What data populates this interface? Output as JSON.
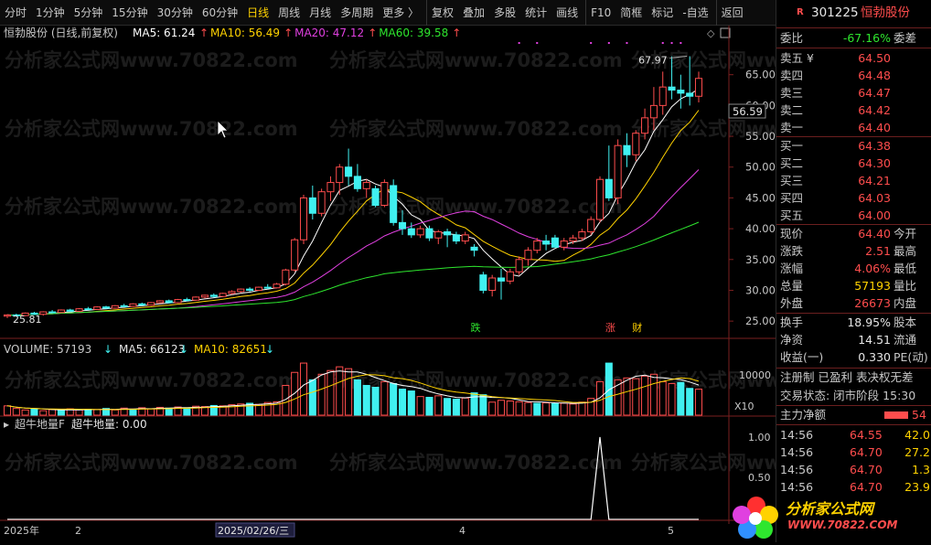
{
  "toolbar": {
    "items": [
      "分时",
      "1分钟",
      "5分钟",
      "15分钟",
      "30分钟",
      "60分钟",
      "日线",
      "周线",
      "月线",
      "多周期",
      "更多 〉",
      "复权",
      "叠加",
      "多股",
      "统计",
      "画线",
      "F10",
      "简框",
      "标记",
      "-自选",
      "返回"
    ],
    "active": "日线"
  },
  "stock": {
    "code": "301225",
    "name": "恒勃股份",
    "market_badge": "R"
  },
  "price_panel": {
    "title": "恒勃股份 (日线,前复权)",
    "ma": [
      {
        "label": "MA5: 61.24",
        "color": "#ffffff"
      },
      {
        "label": "MA10: 56.49",
        "color": "#ffd200"
      },
      {
        "label": "MA20: 47.12",
        "color": "#e040e0"
      },
      {
        "label": "MA60: 39.58",
        "color": "#2ee62e"
      }
    ],
    "up_arrow": "↑",
    "current_price_tag": "56.59",
    "high_label": "67.97",
    "low_label": "25.81",
    "events": [
      "跌",
      "涨",
      "财"
    ],
    "watermark": "分析家公式网www.70822.com"
  },
  "volume_panel": {
    "title": "VOLUME: 57193",
    "ma5": "MA5: 66123",
    "ma10": "MA10: 82651",
    "down_arrow": "↓",
    "unit_label": "X10",
    "tick": "10000"
  },
  "indicator_panel": {
    "title": "超牛地量F",
    "value": "超牛地量: 0.00",
    "ticks": [
      "1.00",
      "0.50"
    ]
  },
  "x_axis": {
    "labels": [
      "2025年",
      "2",
      "2025/02/26/三",
      "4",
      "5"
    ]
  },
  "logo": {
    "text": "分析家公式网",
    "url_text": "WWW.70822.COM"
  },
  "chart_data": [
    {
      "type": "candlestick",
      "title": "恒勃股份 (日线,前复权)",
      "ylim": [
        22.5,
        70
      ],
      "yticks": [
        25,
        30,
        35,
        40,
        45,
        50,
        55,
        60,
        65
      ],
      "candles": [
        [
          25.8,
          26.1,
          25.5,
          26.0
        ],
        [
          26.0,
          26.2,
          25.7,
          25.9
        ],
        [
          25.9,
          26.4,
          25.8,
          26.3
        ],
        [
          26.3,
          26.5,
          26.0,
          26.1
        ],
        [
          26.1,
          26.6,
          25.9,
          26.5
        ],
        [
          26.5,
          26.8,
          26.3,
          26.4
        ],
        [
          26.4,
          26.9,
          26.3,
          26.8
        ],
        [
          26.8,
          27.0,
          26.5,
          26.6
        ],
        [
          26.6,
          27.1,
          26.5,
          27.0
        ],
        [
          27.0,
          27.3,
          26.8,
          26.9
        ],
        [
          26.9,
          27.4,
          26.8,
          27.3
        ],
        [
          27.3,
          27.5,
          27.0,
          27.1
        ],
        [
          27.1,
          27.6,
          27.0,
          27.5
        ],
        [
          27.5,
          27.8,
          27.3,
          27.4
        ],
        [
          27.4,
          27.9,
          27.3,
          27.8
        ],
        [
          27.8,
          28.0,
          27.5,
          27.6
        ],
        [
          27.6,
          28.1,
          27.5,
          28.0
        ],
        [
          28.0,
          28.4,
          27.9,
          28.3
        ],
        [
          28.3,
          28.5,
          27.9,
          28.0
        ],
        [
          28.0,
          28.6,
          27.9,
          28.5
        ],
        [
          28.5,
          28.8,
          28.2,
          28.4
        ],
        [
          28.4,
          29.0,
          28.3,
          28.9
        ],
        [
          28.9,
          29.3,
          28.7,
          29.2
        ],
        [
          29.2,
          29.5,
          28.8,
          29.0
        ],
        [
          29.0,
          29.6,
          28.9,
          29.5
        ],
        [
          29.5,
          30.0,
          29.3,
          29.8
        ],
        [
          29.8,
          30.3,
          29.6,
          30.2
        ],
        [
          30.2,
          30.5,
          29.8,
          30.0
        ],
        [
          30.0,
          30.6,
          29.9,
          30.5
        ],
        [
          30.5,
          31.0,
          30.2,
          30.4
        ],
        [
          30.4,
          31.2,
          30.3,
          31.0
        ],
        [
          31.0,
          33.5,
          30.8,
          33.3
        ],
        [
          33.3,
          38.5,
          33.0,
          38.2
        ],
        [
          38.2,
          45.5,
          37.5,
          45.0
        ],
        [
          45.0,
          47.0,
          41.5,
          42.5
        ],
        [
          42.5,
          46.5,
          42.0,
          46.0
        ],
        [
          46.0,
          48.5,
          44.5,
          47.5
        ],
        [
          47.5,
          50.5,
          45.5,
          50.0
        ],
        [
          50.0,
          53.0,
          47.0,
          48.5
        ],
        [
          48.5,
          50.5,
          46.0,
          46.5
        ],
        [
          46.5,
          48.0,
          45.0,
          47.5
        ],
        [
          46.5,
          47.0,
          43.5,
          43.8
        ],
        [
          43.8,
          48.0,
          43.5,
          47.5
        ],
        [
          47.0,
          48.0,
          40.5,
          41.0
        ],
        [
          41.0,
          43.0,
          39.0,
          40.0
        ],
        [
          40.0,
          41.0,
          38.5,
          39.0
        ],
        [
          39.0,
          40.5,
          38.5,
          40.0
        ],
        [
          40.0,
          40.5,
          38.0,
          38.5
        ],
        [
          38.5,
          39.8,
          37.5,
          39.5
        ],
        [
          39.5,
          40.0,
          37.0,
          39.0
        ],
        [
          39.0,
          39.5,
          37.5,
          38.0
        ],
        [
          38.0,
          39.5,
          37.5,
          39.0
        ],
        [
          37.0,
          37.5,
          35.5,
          36.5
        ],
        [
          32.5,
          33.0,
          29.5,
          30.0
        ],
        [
          30.0,
          32.5,
          29.0,
          32.0
        ],
        [
          32.0,
          33.5,
          28.5,
          31.5
        ],
        [
          31.5,
          33.5,
          31.0,
          33.0
        ],
        [
          33.0,
          35.5,
          32.5,
          35.0
        ],
        [
          35.0,
          37.0,
          34.0,
          36.5
        ],
        [
          36.5,
          38.5,
          36.0,
          38.0
        ],
        [
          38.0,
          39.0,
          36.5,
          37.5
        ],
        [
          38.5,
          39.0,
          37.0,
          37.0
        ],
        [
          37.0,
          38.5,
          36.5,
          38.0
        ],
        [
          38.0,
          39.0,
          37.5,
          38.5
        ],
        [
          38.5,
          40.0,
          38.0,
          39.5
        ],
        [
          39.5,
          42.0,
          39.0,
          41.5
        ],
        [
          41.5,
          48.5,
          41.0,
          48.0
        ],
        [
          48.0,
          53.5,
          44.5,
          45.0
        ],
        [
          45.0,
          54.5,
          44.0,
          53.5
        ],
        [
          53.5,
          55.5,
          50.0,
          52.0
        ],
        [
          52.0,
          56.0,
          51.0,
          55.5
        ],
        [
          55.5,
          59.5,
          54.5,
          58.0
        ],
        [
          58.0,
          63.0,
          56.0,
          60.0
        ],
        [
          60.0,
          65.5,
          58.5,
          63.0
        ],
        [
          63.0,
          67.97,
          61.0,
          62.5
        ],
        [
          62.5,
          65.0,
          59.5,
          62.0
        ],
        [
          62.0,
          68.0,
          60.0,
          61.5
        ],
        [
          61.5,
          65.5,
          60.5,
          64.4
        ]
      ]
    },
    {
      "type": "bar",
      "title": "VOLUME",
      "ylim": [
        0,
        15000
      ],
      "values": [
        2500,
        1800,
        1400,
        1600,
        1200,
        1500,
        1300,
        1700,
        1400,
        1600,
        1500,
        1800,
        1400,
        1900,
        1600,
        2000,
        1700,
        2100,
        1900,
        2200,
        2000,
        2400,
        2300,
        2600,
        2500,
        2800,
        3000,
        3200,
        2900,
        3400,
        3600,
        8000,
        11500,
        14000,
        9500,
        11000,
        12000,
        13000,
        12500,
        9500,
        8000,
        7500,
        9000,
        8500,
        7000,
        6500,
        5000,
        4800,
        5200,
        4500,
        4300,
        4600,
        6000,
        5500,
        3500,
        4000,
        3800,
        3600,
        3400,
        3200,
        3300,
        3100,
        3200,
        3000,
        3500,
        4500,
        9000,
        14000,
        9500,
        10000,
        9800,
        10500,
        11000,
        9000,
        8500,
        8800,
        7200,
        7000
      ],
      "colors": [
        "r",
        "r",
        "r",
        "c",
        "r",
        "r",
        "c",
        "r",
        "r",
        "c",
        "r",
        "c",
        "r",
        "r",
        "c",
        "r",
        "r",
        "r",
        "c",
        "r",
        "c",
        "r",
        "r",
        "c",
        "r",
        "r",
        "r",
        "c",
        "r",
        "r",
        "r",
        "r",
        "r",
        "r",
        "c",
        "r",
        "r",
        "r",
        "r",
        "c",
        "c",
        "c",
        "r",
        "c",
        "c",
        "c",
        "r",
        "c",
        "r",
        "c",
        "c",
        "r",
        "c",
        "c",
        "r",
        "r",
        "r",
        "r",
        "r",
        "c",
        "r",
        "c",
        "r",
        "r",
        "r",
        "r",
        "r",
        "c",
        "r",
        "r",
        "r",
        "r",
        "r",
        "r",
        "r",
        "c",
        "c",
        "r"
      ],
      "ma5_label": "MA5: 66123",
      "ma10_label": "MA10: 82651"
    },
    {
      "type": "line",
      "title": "超牛地量F",
      "ylim": [
        0,
        1.0
      ],
      "values": [
        0,
        0,
        0,
        0,
        0,
        0,
        0,
        0,
        0,
        0,
        0,
        0,
        0,
        0,
        0,
        0,
        0,
        0,
        0,
        0,
        0,
        0,
        0,
        0,
        0,
        0,
        0,
        0,
        0,
        0,
        0,
        0,
        0,
        0,
        0,
        0,
        0,
        0,
        0,
        0,
        0,
        0,
        0,
        0,
        0,
        0,
        0,
        0,
        0,
        0,
        0,
        0,
        0,
        0,
        0,
        0,
        0,
        0,
        0,
        0,
        0,
        0,
        0,
        0,
        0,
        0,
        1,
        0,
        0,
        0,
        0,
        0,
        0,
        0,
        0,
        0,
        0,
        0
      ]
    }
  ],
  "quote": {
    "weibi": {
      "label": "委比",
      "value": "-67.16%",
      "right": "委差"
    },
    "asks": [
      {
        "label": "卖五",
        "extra": "¥",
        "price": "64.50"
      },
      {
        "label": "卖四",
        "price": "64.48"
      },
      {
        "label": "卖三",
        "price": "64.47"
      },
      {
        "label": "卖二",
        "price": "64.42"
      },
      {
        "label": "卖一",
        "price": "64.40"
      }
    ],
    "bids": [
      {
        "label": "买一",
        "price": "64.38"
      },
      {
        "label": "买二",
        "price": "64.30"
      },
      {
        "label": "买三",
        "price": "64.21"
      },
      {
        "label": "买四",
        "price": "64.03"
      },
      {
        "label": "买五",
        "price": "64.00"
      }
    ],
    "stats": [
      {
        "label": "现价",
        "value": "64.40",
        "right": "今开",
        "cls": "red"
      },
      {
        "label": "涨跌",
        "value": "2.51",
        "right": "最高",
        "cls": "red"
      },
      {
        "label": "涨幅",
        "value": "4.06%",
        "right": "最低",
        "cls": "red"
      },
      {
        "label": "总量",
        "value": "57193",
        "right": "量比",
        "cls": "yellow"
      },
      {
        "label": "外盘",
        "value": "26673",
        "right": "内盘",
        "cls": "red"
      }
    ],
    "fin": [
      {
        "label": "换手",
        "value": "18.95%",
        "right": "股本"
      },
      {
        "label": "净资",
        "value": "14.51",
        "right": "流通"
      },
      {
        "label": "收益(一)",
        "value": "0.330",
        "right": "PE(动)"
      }
    ],
    "tags": "注册制 已盈利 表决权无差",
    "trade_status": "交易状态: 闭市阶段 15:30",
    "main_flow": {
      "label": "主力净额",
      "value": "54"
    },
    "ticks": [
      {
        "time": "14:56",
        "price": "64.55",
        "vol": "42.0"
      },
      {
        "time": "14:56",
        "price": "64.70",
        "vol": "27.2"
      },
      {
        "time": "14:56",
        "price": "64.70",
        "vol": "1.3"
      },
      {
        "time": "14:56",
        "price": "64.70",
        "vol": "23.9"
      }
    ]
  }
}
